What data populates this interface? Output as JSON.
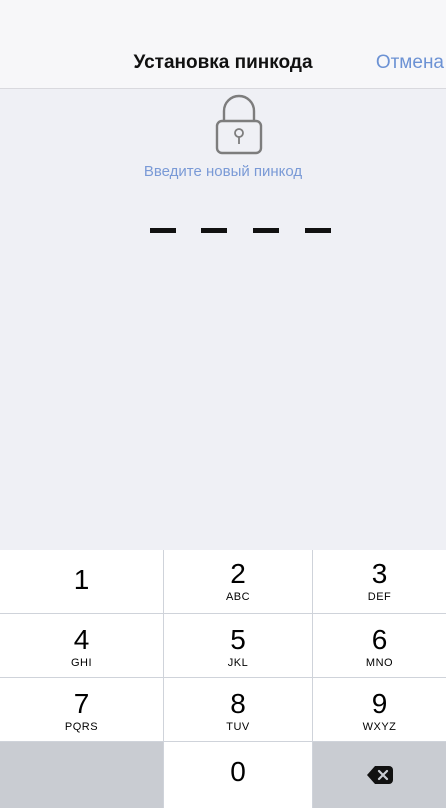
{
  "nav": {
    "title": "Установка пинкода",
    "cancel_label": "Отмена"
  },
  "lock": {
    "icon": "lock-icon",
    "prompt": "Введите новый пинкод"
  },
  "pin": {
    "length": 4,
    "entered": 0
  },
  "keypad": {
    "keys": [
      {
        "num": "1",
        "letters": ""
      },
      {
        "num": "2",
        "letters": "ABC"
      },
      {
        "num": "3",
        "letters": "DEF"
      },
      {
        "num": "4",
        "letters": "GHI"
      },
      {
        "num": "5",
        "letters": "JKL"
      },
      {
        "num": "6",
        "letters": "MNO"
      },
      {
        "num": "7",
        "letters": "PQRS"
      },
      {
        "num": "8",
        "letters": "TUV"
      },
      {
        "num": "9",
        "letters": "WXYZ"
      },
      {
        "num": "0",
        "letters": ""
      }
    ],
    "backspace_icon": "backspace-icon"
  },
  "colors": {
    "accent": "#6c92d4",
    "prompt": "#7a9ad6",
    "background": "#eff0f5",
    "keypad_bg": "#cfd3da",
    "key_dark": "#c9ccd2"
  }
}
